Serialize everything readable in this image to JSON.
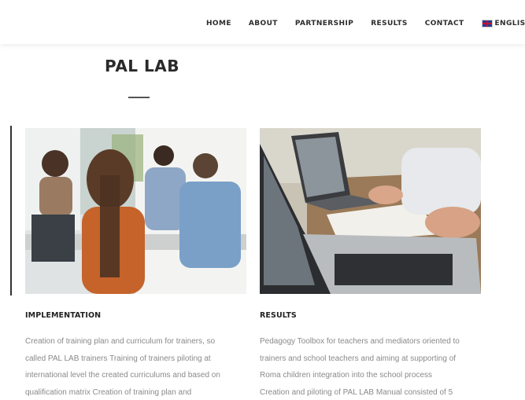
{
  "nav": {
    "items": [
      "HOME",
      "ABOUT",
      "PARTNERSHIP",
      "RESULTS",
      "CONTACT"
    ],
    "language": "ENGLISH",
    "language_icon": "uk-flag-icon"
  },
  "page_title": "PAL LAB",
  "columns": [
    {
      "heading": "IMPLEMENTATION",
      "image": "team-meeting-photo",
      "lines": [
        "Creation of training plan and curriculum for trainers, so",
        "called PAL LAB trainers Training of trainers piloting at",
        "international level the created curriculums and based on",
        "qualification matrix Creation of training plan and"
      ]
    },
    {
      "heading": "RESULTS",
      "image": "laptop-desk-photo",
      "lines": [
        "Pedagogy Toolbox for teachers and mediators oriented to",
        "trainers and school teachers and aiming at supporting of",
        "Roma children integration into the school process",
        "Creation and piloting of PAL LAB Manual consisted of 5"
      ]
    }
  ],
  "colors": {
    "text_heading": "#2a2a2a",
    "text_body": "#8a8a8a",
    "nav_text": "#2d2d2d"
  }
}
